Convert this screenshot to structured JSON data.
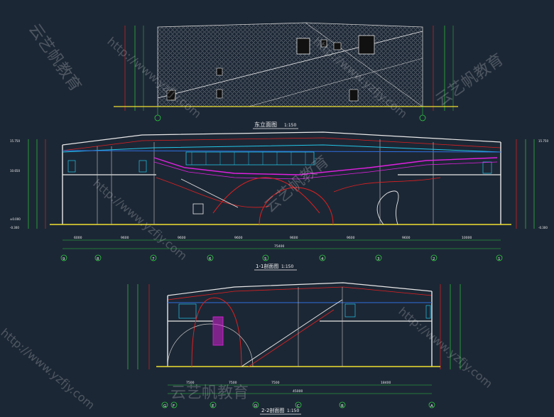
{
  "drawing": {
    "elevation_east": {
      "title": "东立面图",
      "scale": "1:150"
    },
    "section_1": {
      "title": "1-1剖面图",
      "scale": "1:150",
      "axes": [
        "9",
        "8",
        "7",
        "6",
        "5",
        "4",
        "3",
        "2",
        "1"
      ],
      "bays": [
        "6000",
        "9600",
        "9600",
        "9600",
        "9600",
        "9600",
        "9600",
        "10000"
      ],
      "total": "75400"
    },
    "section_2": {
      "title": "2-2剖面图",
      "scale": "1:150",
      "axes": [
        "G",
        "F",
        "E",
        "D",
        "C",
        "B",
        "A"
      ],
      "bays": [
        "7500",
        "7500",
        "7500",
        "18400"
      ],
      "total": "45000"
    },
    "levels": [
      "15.750",
      "10.650",
      "4.800",
      "±0.000",
      "-0.300"
    ],
    "watermark": [
      "云艺帆教育",
      "http://www.yzfjy.com"
    ]
  },
  "colors": {
    "background": "#1c2735",
    "structure": "#f2f2f2",
    "grid": "#2ecc40",
    "red": "#e02020",
    "magenta": "#e020e0",
    "cyan": "#22c7e8",
    "yellow": "#f0e030",
    "blue": "#2f6fe0"
  }
}
